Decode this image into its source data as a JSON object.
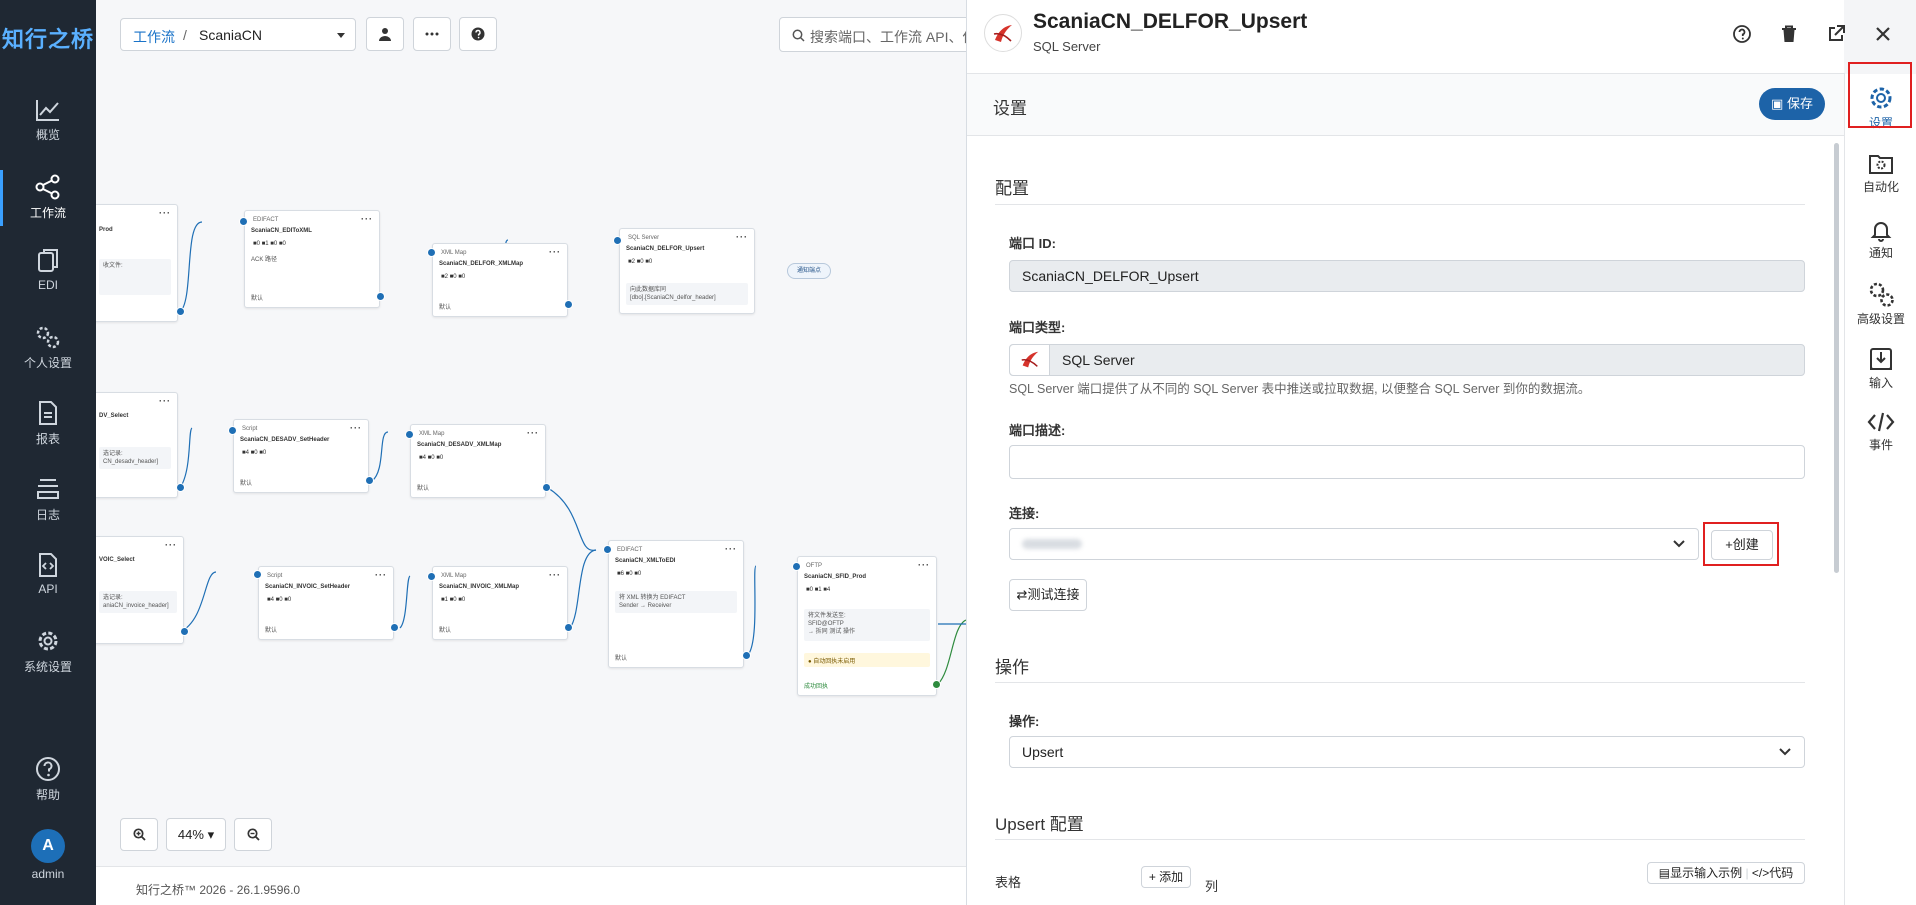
{
  "brand": "知行之桥",
  "nav": [
    {
      "label": "概览",
      "icon": "chart-icon"
    },
    {
      "label": "工作流",
      "icon": "share-icon"
    },
    {
      "label": "EDI",
      "icon": "documents-icon"
    },
    {
      "label": "个人设置",
      "icon": "gears-icon"
    },
    {
      "label": "报表",
      "icon": "report-icon"
    },
    {
      "label": "日志",
      "icon": "stack-icon"
    },
    {
      "label": "API",
      "icon": "api-icon"
    },
    {
      "label": "系统设置",
      "icon": "gear-icon"
    }
  ],
  "nav_bottom": {
    "help": "帮助",
    "avatar_letter": "A",
    "user": "admin"
  },
  "canvas": {
    "breadcrumb_root": "工作流",
    "breadcrumb_sep": "/",
    "breadcrumb_current": "ScaniaCN",
    "search_placeholder": "搜索端口、工作流 API、保",
    "zoom": "44%",
    "version": "知行之桥™ 2026 - 26.1.9596.0",
    "pill": "通知端点"
  },
  "nodes": [
    {
      "type": "",
      "name": "Prod",
      "stats": "",
      "info": "收文件:",
      "footer": ""
    },
    {
      "type": "EDIFACT",
      "name": "ScaniaCN_EDIToXML",
      "stats": "■0  ■1  ■0  ■0",
      "info": "ACK 路径",
      "footer": "默认"
    },
    {
      "type": "XML Map",
      "name": "ScaniaCN_DELFOR_XMLMap",
      "stats": "■2  ■0  ■0",
      "info": "",
      "footer": "默认"
    },
    {
      "type": "SQL Server",
      "name": "ScaniaCN_DELFOR_Upsert",
      "stats": "■2  ■0  ■0",
      "info": "向此数据库同\n[dbo].[ScaniaCN_delfor_header]",
      "footer": ""
    },
    {
      "type": "",
      "name": "DV_Select",
      "stats": "",
      "info": "选记录:\nCN_desadv_header]",
      "footer": ""
    },
    {
      "type": "Script",
      "name": "ScaniaCN_DESADV_SetHeader",
      "stats": "■4  ■0  ■0",
      "info": "",
      "footer": "默认"
    },
    {
      "type": "XML Map",
      "name": "ScaniaCN_DESADV_XMLMap",
      "stats": "■4  ■0  ■0",
      "info": "",
      "footer": "默认"
    },
    {
      "type": "",
      "name": "VOIC_Select",
      "stats": "",
      "info": "选记录:\naniaCN_invoice_header]",
      "footer": ""
    },
    {
      "type": "Script",
      "name": "ScaniaCN_INVOIC_SetHeader",
      "stats": "■4  ■0  ■0",
      "info": "",
      "footer": "默认"
    },
    {
      "type": "XML Map",
      "name": "ScaniaCN_INVOIC_XMLMap",
      "stats": "■1  ■0  ■0",
      "info": "",
      "footer": "默认"
    },
    {
      "type": "EDIFACT",
      "name": "ScaniaCN_XMLToEDI",
      "stats": "■6  ■0  ■0",
      "info": "将 XML 转换为 EDIFACT\nSender → Receiver",
      "footer": "默认"
    },
    {
      "type": "OFTP",
      "name": "ScaniaCN_SFID_Prod",
      "stats": "■0  ■1  ■4",
      "info": "将文件发送至:\nSFID@OFTP\n→ 拆同 测试 操作",
      "footer": "成功回执",
      "warn": "● 自动回执未启用"
    }
  ],
  "panel": {
    "title": "ScaniaCN_DELFOR_Upsert",
    "subtitle": "SQL Server",
    "settings_title": "设置",
    "save": "保存",
    "section_config": "配置",
    "port_id_label": "端口 ID:",
    "port_id_value": "ScaniaCN_DELFOR_Upsert",
    "port_type_label": "端口类型:",
    "port_type_value": "SQL Server",
    "port_type_desc": "SQL Server 端口提供了从不同的 SQL Server 表中推送或拉取数据, 以便整合 SQL Server 到你的数据流。",
    "port_desc_label": "端口描述:",
    "port_desc_value": "",
    "conn_label": "连接:",
    "conn_value": " ",
    "create": "创建",
    "test_conn": "测试连接",
    "section_ops": "操作",
    "op_label": "操作:",
    "op_value": "Upsert",
    "section_upsert": "Upsert 配置",
    "table_label": "表格",
    "add": "添加",
    "columns_label": "列",
    "show_sample": "显示输入示例",
    "code": "代码"
  },
  "rail": [
    {
      "label": "设置",
      "icon": "settings-gear-icon"
    },
    {
      "label": "自动化",
      "icon": "automation-icon"
    },
    {
      "label": "通知",
      "icon": "bell-icon"
    },
    {
      "label": "高级设置",
      "icon": "advanced-gears-icon"
    },
    {
      "label": "输入",
      "icon": "input-icon"
    },
    {
      "label": "事件",
      "icon": "code-icon"
    }
  ],
  "colors": {
    "nav_bg": "#1f2833",
    "accent": "#1d63a8",
    "highlight": "#e02020"
  }
}
